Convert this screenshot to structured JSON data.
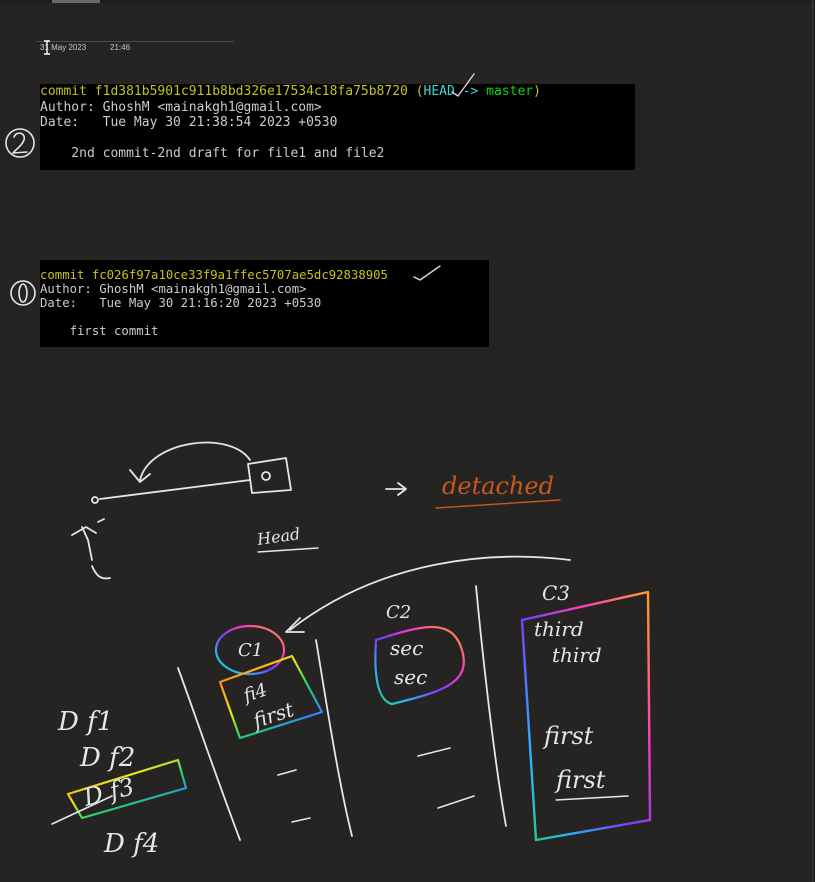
{
  "page": {
    "date": "31 May 2023",
    "time": "21:46"
  },
  "commit1": {
    "commit_word": "commit",
    "hash": "f1d381b5901c911b8bd326e17534c18fa75b8720",
    "ref_open": "(",
    "head": "HEAD ->",
    "branch": "master",
    "ref_close": ")",
    "author_line": "Author: GhoshM <mainakgh1@gmail.com>",
    "date_line": "Date:   Tue May 30 21:38:54 2023 +0530",
    "message": "    2nd commit-2nd draft for file1 and file2"
  },
  "commit2": {
    "commit_word": "commit",
    "hash": "fc026f97a10ce33f9a1ffec5707ae5dc92838905",
    "author_line": "Author: GhoshM <mainakgh1@gmail.com>",
    "date_line": "Date:   Tue May 30 21:16:20 2023 +0530",
    "message": "    first commit"
  },
  "handwriting": {
    "detached": "detached",
    "head": "Head",
    "c1": "C1",
    "c2": "C2",
    "c3": "C3",
    "c1_lines": [
      "fi4",
      "first"
    ],
    "c2_lines": [
      "sec",
      "sec"
    ],
    "c3_lines": [
      "third",
      "third",
      "first",
      "first"
    ],
    "files": [
      "D f1",
      "D f2",
      "D f3",
      "D f4"
    ]
  },
  "colors": {
    "background": "#252423",
    "terminal_bg": "#000000",
    "hash_yellow": "#c5c21c",
    "head_cyan": "#3ad6d6",
    "branch_green": "#13d413",
    "detached_orange": "#c8581d",
    "ink_white": "#e6e6e6"
  }
}
